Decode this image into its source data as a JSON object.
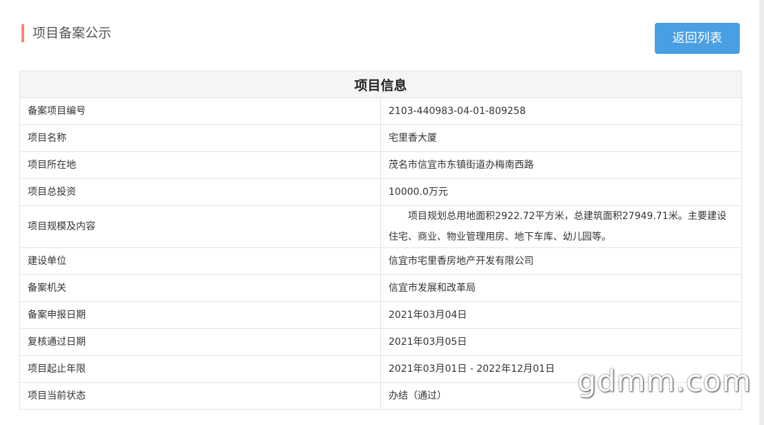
{
  "header": {
    "title": "项目备案公示",
    "back_label": "返回列表"
  },
  "table": {
    "heading": "项目信息",
    "rows": [
      {
        "label": "备案项目编号",
        "value": "2103-440983-04-01-809258"
      },
      {
        "label": "项目名称",
        "value": "宅里香大厦"
      },
      {
        "label": "项目所在地",
        "value": "茂名市信宜市东镇街道办梅南西路"
      },
      {
        "label": "项目总投资",
        "value": "10000.0万元"
      },
      {
        "label": "项目规模及内容",
        "value": "项目规划总用地面积2922.72平方米，总建筑面积27949.71米。主要建设住宅、商业、物业管理用房、地下车库、幼儿园等。"
      },
      {
        "label": "建设单位",
        "value": "信宜市宅里香房地产开发有限公司"
      },
      {
        "label": "备案机关",
        "value": "信宜市发展和改革局"
      },
      {
        "label": "备案申报日期",
        "value": "2021年03月04日"
      },
      {
        "label": "复核通过日期",
        "value": "2021年03月05日"
      },
      {
        "label": "项目起止年限",
        "value": "2021年03月01日 - 2022年12月01日"
      },
      {
        "label": "项目当前状态",
        "value": "办结（通过）"
      }
    ]
  },
  "watermark": "gdmm.com",
  "colors": {
    "accent_bar": "#f08a6e",
    "button": "#4a9fe3",
    "table_heading_bg": "#f5f5f5",
    "border": "#e3e3e3"
  }
}
